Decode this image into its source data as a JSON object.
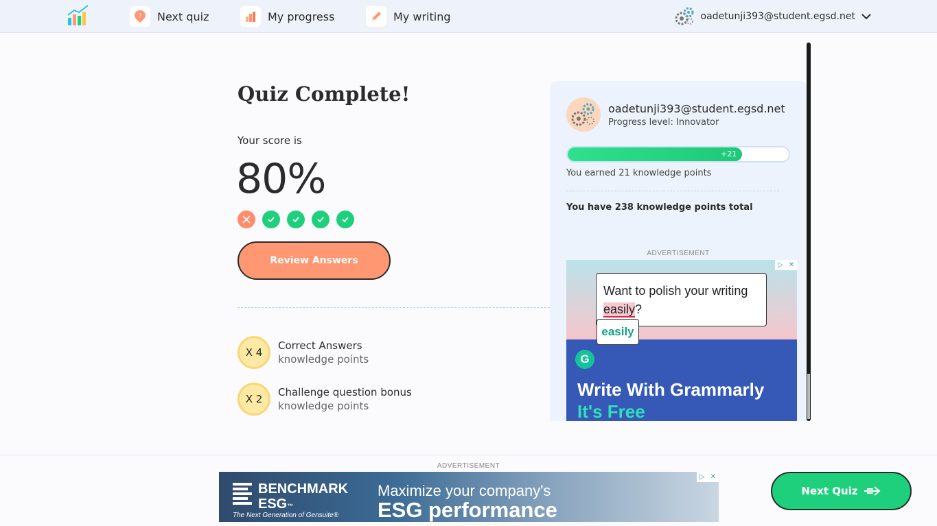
{
  "nav": {
    "items": [
      {
        "label": "Next quiz",
        "icon": "map-pin-icon"
      },
      {
        "label": "My progress",
        "icon": "bar-chart-icon"
      },
      {
        "label": "My writing",
        "icon": "pencil-icon"
      }
    ],
    "user_email": "oadetunji393@student.egsd.net"
  },
  "quiz": {
    "title": "Quiz Complete!",
    "score_label": "Your score is",
    "score": "80%",
    "results": [
      "wrong",
      "correct",
      "correct",
      "correct",
      "correct"
    ],
    "review_button": "Review Answers"
  },
  "points": [
    {
      "multiplier": "X 4",
      "title": "Correct Answers",
      "subtitle": "knowledge points"
    },
    {
      "multiplier": "X 2",
      "title": "Challenge question bonus",
      "subtitle": "knowledge points"
    }
  ],
  "profile": {
    "email": "oadetunji393@student.egsd.net",
    "level": "Progress level: Innovator",
    "progress_fraction": 0.79,
    "progress_label": "+21",
    "earned_text": "You earned 21 knowledge points",
    "total_text": "You have 238 knowledge points total"
  },
  "ads": {
    "label": "ADVERTISEMENT",
    "side": {
      "bubble_text": "Want to polish your writing",
      "bubble_word": "easily",
      "bubble_punct": "?",
      "suggestion": "easily",
      "brand_letter": "G",
      "headline": "Write With Grammarly",
      "subline": "It's Free"
    },
    "bottom": {
      "brand_line1": "BENCHMARK",
      "brand_line2": "ESG",
      "brand_tm": "™",
      "tagline": "The Next Generation of Gensuite®",
      "headline1": "Maximize your company's",
      "headline2": "ESG performance"
    },
    "choices_icon": "▷",
    "close_icon": "✕"
  },
  "footer": {
    "next_button": "Next Quiz"
  },
  "colors": {
    "green": "#1ed07c",
    "orange": "#ff9772",
    "coin": "#fce9a3"
  }
}
